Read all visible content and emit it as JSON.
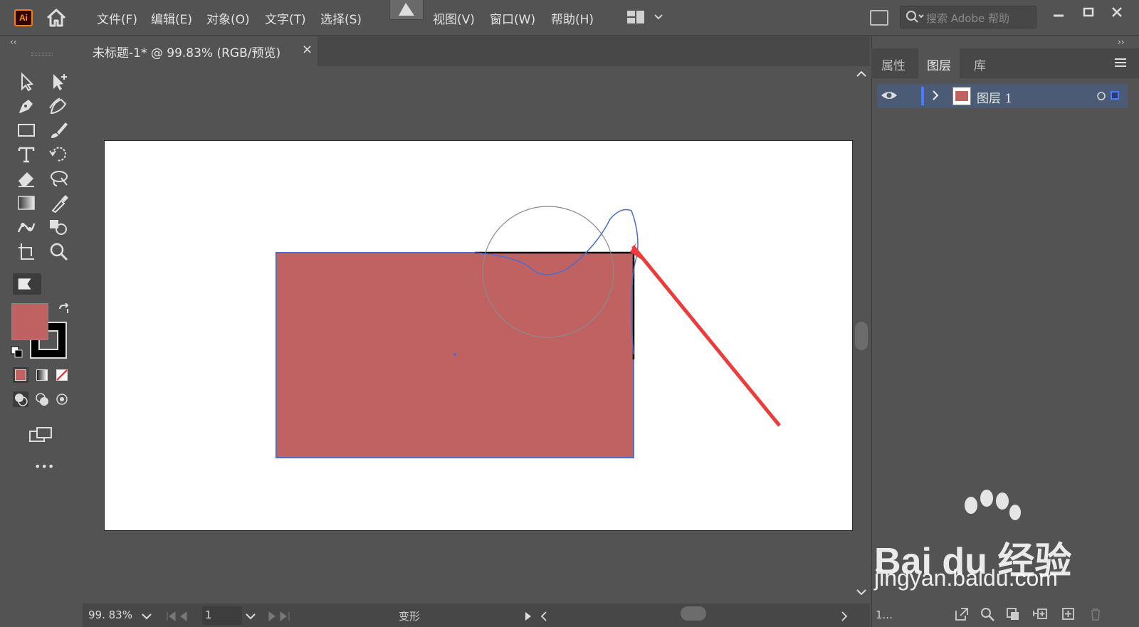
{
  "app": {
    "logo_text": "Ai"
  },
  "menu": [
    {
      "label": "文件(F)"
    },
    {
      "label": "编辑(E)"
    },
    {
      "label": "对象(O)"
    },
    {
      "label": "文字(T)"
    },
    {
      "label": "选择(S)"
    },
    {
      "label": "视图(V)"
    },
    {
      "label": "窗口(W)"
    },
    {
      "label": "帮助(H)"
    }
  ],
  "search": {
    "placeholder": "搜索 Adobe 帮助"
  },
  "document_tab": {
    "title": "未标题-1* @ 99.83% (RGB/预览)",
    "close_symbol": "×"
  },
  "colors": {
    "fill": "#c06262",
    "stroke": "#000000",
    "selection": "#4a6fd0",
    "arrow": "#f03a3a"
  },
  "toolbar": {
    "tools": [
      "selection-icon",
      "direct-selection-icon",
      "pen-icon",
      "curvature-icon",
      "rectangle-icon",
      "paintbrush-icon",
      "type-icon",
      "rotate-icon",
      "eraser-icon",
      "lasso-icon",
      "gradient-icon",
      "eyedropper-icon",
      "puppet-warp-icon",
      "shape-builder-icon",
      "artboard-icon",
      "zoom-icon"
    ],
    "more_label": "•••"
  },
  "status": {
    "zoom": "99. 83%",
    "page": "1",
    "mode": "变形"
  },
  "panel": {
    "tabs": [
      {
        "label": "属性",
        "active": false
      },
      {
        "label": "图层",
        "active": true
      },
      {
        "label": "库",
        "active": false
      }
    ],
    "layers": [
      {
        "name": "图层 1"
      }
    ],
    "footer_count": "1..."
  },
  "watermark": {
    "logo": "Bai du 经验",
    "url": "jingyan.baidu.com"
  }
}
